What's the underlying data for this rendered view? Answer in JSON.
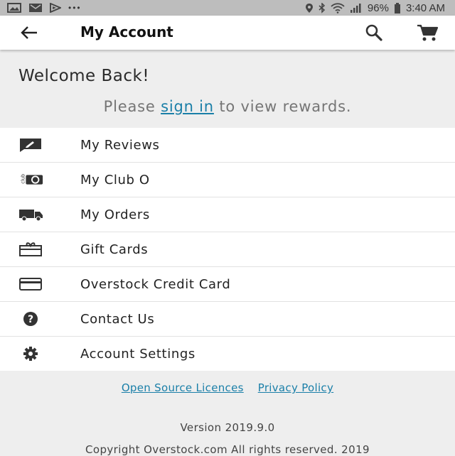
{
  "status_bar": {
    "battery": "96%",
    "time": "3:40 AM",
    "dots": "•••"
  },
  "app_bar": {
    "title": "My Account"
  },
  "welcome": {
    "title": "Welcome Back!",
    "prompt_before": "Please ",
    "sign_in": "sign in",
    "prompt_after": " to view rewards."
  },
  "menu": {
    "items": [
      {
        "label": "My Reviews",
        "icon": "review-icon"
      },
      {
        "label": "My Club O",
        "icon": "club-o-icon"
      },
      {
        "label": "My Orders",
        "icon": "truck-icon"
      },
      {
        "label": "Gift Cards",
        "icon": "gift-card-icon"
      },
      {
        "label": "Overstock Credit Card",
        "icon": "credit-card-icon"
      },
      {
        "label": "Contact Us",
        "icon": "help-icon"
      },
      {
        "label": "Account Settings",
        "icon": "gear-icon"
      }
    ]
  },
  "footer": {
    "open_source": "Open Source Licences",
    "privacy": "Privacy Policy",
    "version": "Version 2019.9.0",
    "copyright": "Copyright Overstock.com All rights reserved. 2019"
  },
  "colors": {
    "link": "#1a7fa8",
    "background": "#eeeeee",
    "surface": "#ffffff",
    "status_bar": "#bdbdbd"
  }
}
